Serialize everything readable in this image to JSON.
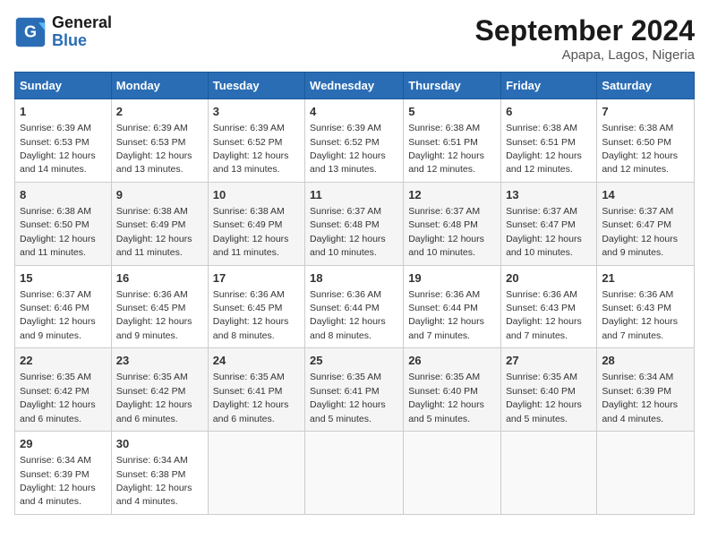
{
  "header": {
    "logo_line1": "General",
    "logo_line2": "Blue",
    "month": "September 2024",
    "location": "Apapa, Lagos, Nigeria"
  },
  "days_of_week": [
    "Sunday",
    "Monday",
    "Tuesday",
    "Wednesday",
    "Thursday",
    "Friday",
    "Saturday"
  ],
  "weeks": [
    [
      {
        "day": "1",
        "sunrise": "6:39 AM",
        "sunset": "6:53 PM",
        "daylight": "12 hours and 14 minutes."
      },
      {
        "day": "2",
        "sunrise": "6:39 AM",
        "sunset": "6:53 PM",
        "daylight": "12 hours and 13 minutes."
      },
      {
        "day": "3",
        "sunrise": "6:39 AM",
        "sunset": "6:52 PM",
        "daylight": "12 hours and 13 minutes."
      },
      {
        "day": "4",
        "sunrise": "6:39 AM",
        "sunset": "6:52 PM",
        "daylight": "12 hours and 13 minutes."
      },
      {
        "day": "5",
        "sunrise": "6:38 AM",
        "sunset": "6:51 PM",
        "daylight": "12 hours and 12 minutes."
      },
      {
        "day": "6",
        "sunrise": "6:38 AM",
        "sunset": "6:51 PM",
        "daylight": "12 hours and 12 minutes."
      },
      {
        "day": "7",
        "sunrise": "6:38 AM",
        "sunset": "6:50 PM",
        "daylight": "12 hours and 12 minutes."
      }
    ],
    [
      {
        "day": "8",
        "sunrise": "6:38 AM",
        "sunset": "6:50 PM",
        "daylight": "12 hours and 11 minutes."
      },
      {
        "day": "9",
        "sunrise": "6:38 AM",
        "sunset": "6:49 PM",
        "daylight": "12 hours and 11 minutes."
      },
      {
        "day": "10",
        "sunrise": "6:38 AM",
        "sunset": "6:49 PM",
        "daylight": "12 hours and 11 minutes."
      },
      {
        "day": "11",
        "sunrise": "6:37 AM",
        "sunset": "6:48 PM",
        "daylight": "12 hours and 10 minutes."
      },
      {
        "day": "12",
        "sunrise": "6:37 AM",
        "sunset": "6:48 PM",
        "daylight": "12 hours and 10 minutes."
      },
      {
        "day": "13",
        "sunrise": "6:37 AM",
        "sunset": "6:47 PM",
        "daylight": "12 hours and 10 minutes."
      },
      {
        "day": "14",
        "sunrise": "6:37 AM",
        "sunset": "6:47 PM",
        "daylight": "12 hours and 9 minutes."
      }
    ],
    [
      {
        "day": "15",
        "sunrise": "6:37 AM",
        "sunset": "6:46 PM",
        "daylight": "12 hours and 9 minutes."
      },
      {
        "day": "16",
        "sunrise": "6:36 AM",
        "sunset": "6:45 PM",
        "daylight": "12 hours and 9 minutes."
      },
      {
        "day": "17",
        "sunrise": "6:36 AM",
        "sunset": "6:45 PM",
        "daylight": "12 hours and 8 minutes."
      },
      {
        "day": "18",
        "sunrise": "6:36 AM",
        "sunset": "6:44 PM",
        "daylight": "12 hours and 8 minutes."
      },
      {
        "day": "19",
        "sunrise": "6:36 AM",
        "sunset": "6:44 PM",
        "daylight": "12 hours and 7 minutes."
      },
      {
        "day": "20",
        "sunrise": "6:36 AM",
        "sunset": "6:43 PM",
        "daylight": "12 hours and 7 minutes."
      },
      {
        "day": "21",
        "sunrise": "6:36 AM",
        "sunset": "6:43 PM",
        "daylight": "12 hours and 7 minutes."
      }
    ],
    [
      {
        "day": "22",
        "sunrise": "6:35 AM",
        "sunset": "6:42 PM",
        "daylight": "12 hours and 6 minutes."
      },
      {
        "day": "23",
        "sunrise": "6:35 AM",
        "sunset": "6:42 PM",
        "daylight": "12 hours and 6 minutes."
      },
      {
        "day": "24",
        "sunrise": "6:35 AM",
        "sunset": "6:41 PM",
        "daylight": "12 hours and 6 minutes."
      },
      {
        "day": "25",
        "sunrise": "6:35 AM",
        "sunset": "6:41 PM",
        "daylight": "12 hours and 5 minutes."
      },
      {
        "day": "26",
        "sunrise": "6:35 AM",
        "sunset": "6:40 PM",
        "daylight": "12 hours and 5 minutes."
      },
      {
        "day": "27",
        "sunrise": "6:35 AM",
        "sunset": "6:40 PM",
        "daylight": "12 hours and 5 minutes."
      },
      {
        "day": "28",
        "sunrise": "6:34 AM",
        "sunset": "6:39 PM",
        "daylight": "12 hours and 4 minutes."
      }
    ],
    [
      {
        "day": "29",
        "sunrise": "6:34 AM",
        "sunset": "6:39 PM",
        "daylight": "12 hours and 4 minutes."
      },
      {
        "day": "30",
        "sunrise": "6:34 AM",
        "sunset": "6:38 PM",
        "daylight": "12 hours and 4 minutes."
      },
      null,
      null,
      null,
      null,
      null
    ]
  ]
}
